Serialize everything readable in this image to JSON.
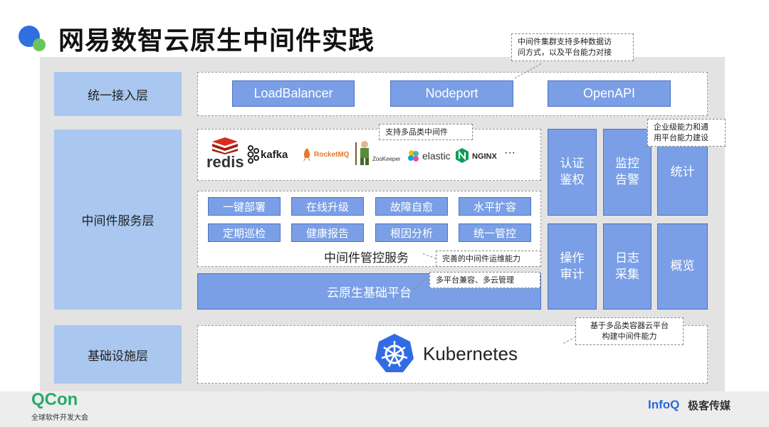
{
  "title": "网易数智云原生中间件实践",
  "layers": {
    "access": "统一接入层",
    "middleware": "中间件服务层",
    "infra": "基础设施层"
  },
  "access_items": [
    "LoadBalancer",
    "Nodeport",
    "OpenAPI"
  ],
  "logos": {
    "redis": "redis",
    "kafka": "kafka",
    "rocketmq": "RocketMQ",
    "zookeeper": "ZooKeeper",
    "elastic": "elastic",
    "nginx": "NGINX",
    "more": "···"
  },
  "control_buttons": [
    "一键部署",
    "在线升级",
    "故障自愈",
    "水平扩容",
    "定期巡检",
    "健康报告",
    "根因分析",
    "统一管控"
  ],
  "control_title": "中间件管控服务",
  "base_platform": "云原生基础平台",
  "side_boxes": {
    "auth": [
      "认证",
      "鉴权"
    ],
    "monitor": [
      "监控",
      "告警"
    ],
    "stats": "统计",
    "audit": [
      "操作",
      "审计"
    ],
    "logs": [
      "日志",
      "采集"
    ],
    "overview": "概览"
  },
  "kubernetes": "Kubernetes",
  "callouts": {
    "access": [
      "中间件集群支持多种数据访",
      "问方式，以及平台能力对接"
    ],
    "multi_type": "支持多品类中间件",
    "enterprise": [
      "企业级能力和通",
      "用平台能力建设"
    ],
    "ops": "完善的中间件运维能力",
    "multicloud": "多平台兼容、多云管理",
    "container": [
      "基于多品类容器云平台",
      "构建中间件能力"
    ]
  },
  "footer": {
    "qcon": "QCon",
    "qcon_sub": "全球软件开发大会",
    "infoq": "InfoQ",
    "infoq_cn": "极客传媒"
  },
  "colors": {
    "accent_blue": "#7a9fe6",
    "label_blue": "#a9c7ef",
    "k8s_blue": "#326ce5",
    "qcon_green": "#29a96b",
    "infoq_blue": "#2a6ad6"
  }
}
